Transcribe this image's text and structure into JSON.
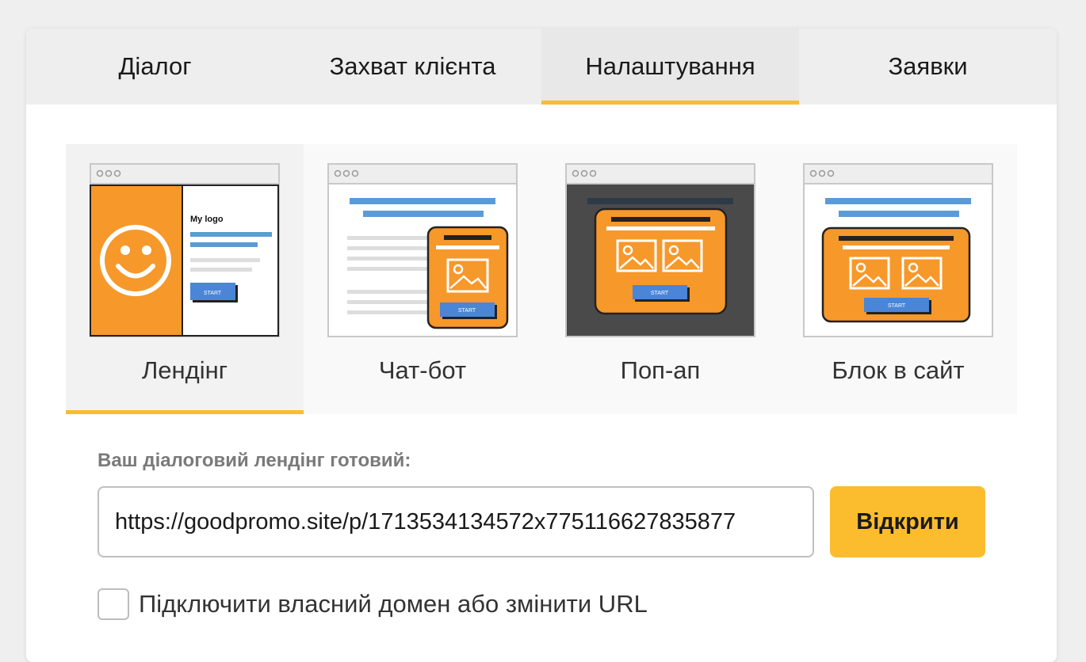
{
  "tabs": [
    {
      "label": "Діалог",
      "active": false
    },
    {
      "label": "Захват клієнта",
      "active": false
    },
    {
      "label": "Налаштування",
      "active": true
    },
    {
      "label": "Заявки",
      "active": false
    }
  ],
  "types": [
    {
      "label": "Лендінг",
      "icon": "landing-preview-icon",
      "active": true
    },
    {
      "label": "Чат-бот",
      "icon": "chatbot-preview-icon",
      "active": false
    },
    {
      "label": "Поп-ап",
      "icon": "popup-preview-icon",
      "active": false
    },
    {
      "label": "Блок в сайт",
      "icon": "site-block-preview-icon",
      "active": false
    }
  ],
  "preview_text": {
    "logo": "My logo",
    "start": "START"
  },
  "ready_label": "Ваш діалоговий лендінг готовий:",
  "url_value": "https://goodpromo.site/p/1713534134572x775116627835877",
  "open_button": "Відкрити",
  "custom_domain_label": "Підключити власний домен або змінити URL",
  "colors": {
    "accent": "#fbbc2e",
    "orange": "#f7982a",
    "blue": "#5b9bd5"
  }
}
